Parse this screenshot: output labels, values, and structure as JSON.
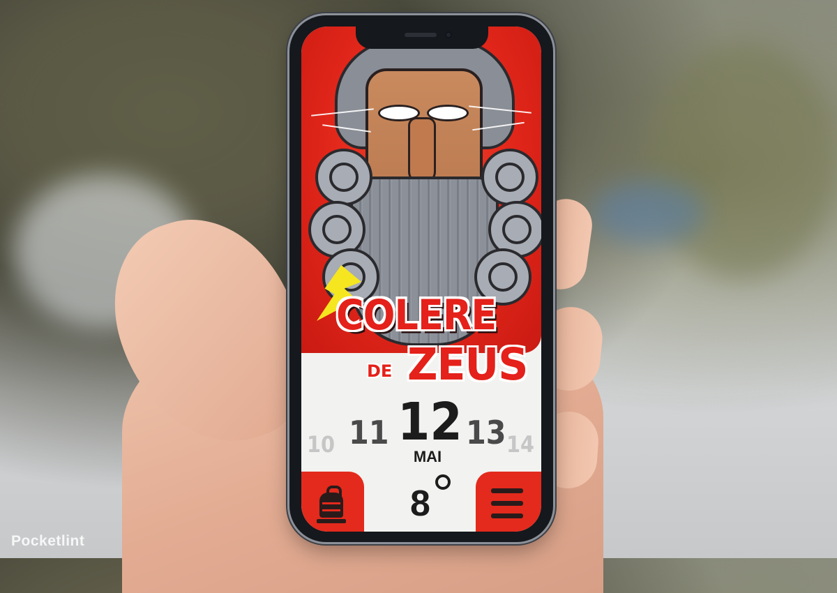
{
  "app": {
    "title_line1": "COLERE",
    "title_de": "DE",
    "title_zeus": "ZEUS"
  },
  "date_picker": {
    "days": [
      "10",
      "11",
      "12",
      "13",
      "14"
    ],
    "selected_day": "12",
    "month": "MAI"
  },
  "weather": {
    "temperature": "8"
  },
  "buttons": {
    "left_icon": "bell-icon",
    "right_icon": "menu-icon"
  },
  "watermark": "Pocketlint",
  "colors": {
    "brand_red": "#e32a1c",
    "bolt_yellow": "#f6e61f",
    "text_dark": "#1c1c1c"
  }
}
